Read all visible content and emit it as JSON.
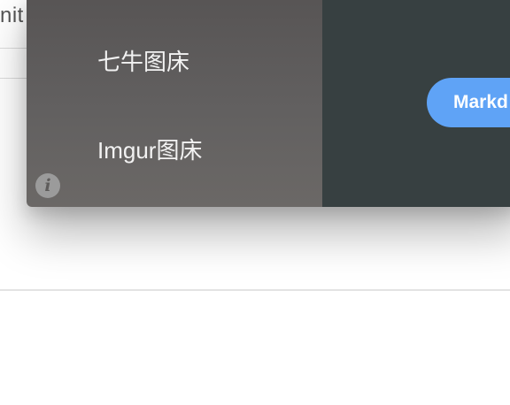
{
  "background": {
    "partial_text": "nit"
  },
  "sidebar": {
    "items": [
      {
        "label": "七牛图床"
      },
      {
        "label": "Imgur图床"
      }
    ],
    "info_icon": "info-icon"
  },
  "content": {
    "button_label": "Markd"
  },
  "colors": {
    "sidebar": "#5e5c5b",
    "content": "#374041",
    "accent": "#5fa3f6"
  }
}
